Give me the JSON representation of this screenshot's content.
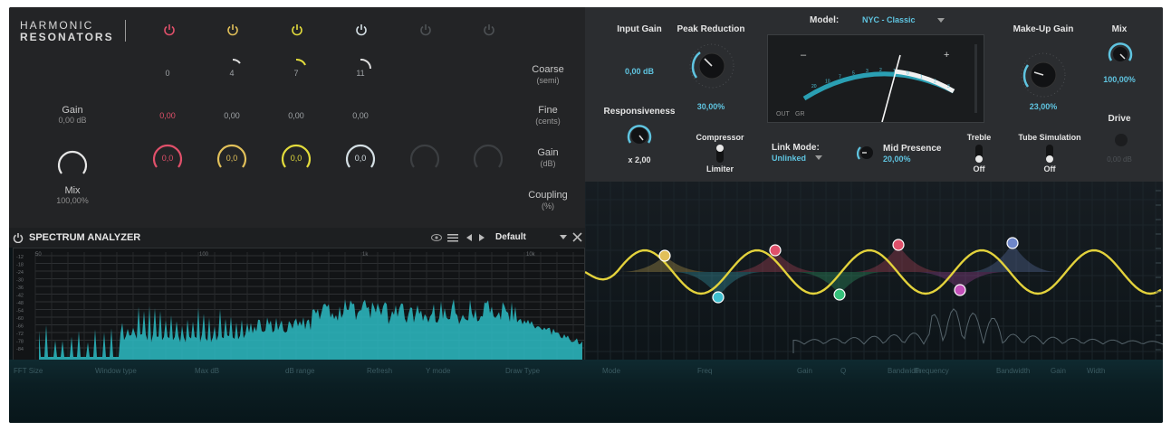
{
  "resonators": {
    "brand_top": "HARMONIC",
    "brand_bottom": "RESONATORS",
    "power_colors": [
      "#e0506a",
      "#e1c05a",
      "#e3dc3c",
      "#d4dfe4",
      "#4d5154",
      "#4d5154"
    ],
    "coarse_values": [
      "0",
      "4",
      "7",
      "11"
    ],
    "fine_values": [
      "0,00",
      "0,00",
      "0,00",
      "0,00"
    ],
    "gain_knob_values": [
      "0,0",
      "0,0",
      "0,0",
      "0,0"
    ],
    "knob_colors": [
      "#e0506a",
      "#e1c05a",
      "#e3dc3c",
      "#d4dfe4",
      "#3c3f42",
      "#3c3f42"
    ],
    "row_coarse": "Coarse",
    "row_coarse_unit": "(semi)",
    "row_fine": "Fine",
    "row_fine_unit": "(cents)",
    "row_gain": "Gain",
    "row_gain_unit": "(dB)",
    "row_coupling": "Coupling",
    "row_coupling_unit": "(%)",
    "gain_label": "Gain",
    "gain_value": "0,00 dB",
    "mix_label": "Mix",
    "mix_value": "100,00%"
  },
  "spectrum": {
    "title": "SPECTRUM ANALYZER",
    "preset": "Default",
    "freq_labels": [
      "50",
      "100",
      "1k",
      "10k"
    ],
    "db_labels": [
      "-12",
      "-18",
      "-24",
      "-30",
      "-36",
      "-42",
      "-48",
      "-54",
      "-60",
      "-66",
      "-72",
      "-78",
      "-84"
    ]
  },
  "compressor": {
    "input_gain_label": "Input Gain",
    "input_gain_value": "0,00 dB",
    "peak_reduction_label": "Peak Reduction",
    "peak_reduction_value": "30,00%",
    "model_label": "Model:",
    "model_value": "NYC - Classic",
    "makeup_label": "Make-Up Gain",
    "makeup_value": "23,00%",
    "mix_label": "Mix",
    "mix_value": "100,00%",
    "responsiveness_label": "Responsiveness",
    "responsiveness_value": "x 2,00",
    "compressor_label": "Compressor",
    "limiter_label": "Limiter",
    "link_mode_label": "Link Mode:",
    "link_mode_value": "Unlinked",
    "mid_presence_label": "Mid Presence",
    "mid_presence_value": "20,00%",
    "treble_label": "Treble",
    "treble_value": "Off",
    "tube_label": "Tube Simulation",
    "tube_value": "Off",
    "drive_label": "Drive",
    "drive_value": "0,00 dB",
    "vu_out": "OUT",
    "vu_gr": "GR",
    "vu_minus": "–",
    "vu_plus": "+",
    "vu_scale": [
      "20",
      "10",
      "7",
      "5",
      "3",
      "2",
      "1",
      "0",
      "1",
      "2",
      "3"
    ]
  },
  "eq": {
    "node_colors": [
      "#e1c05a",
      "#3fbfd0",
      "#e0506a",
      "#35c07a",
      "#e0506a",
      "#c24fb8",
      "#6f87c9"
    ]
  },
  "bottom_bar": {
    "labels": [
      "FFT Size",
      "Window type",
      "Max dB",
      "dB range",
      "Refresh",
      "Y mode",
      "Draw Type",
      "Mode",
      "Freq",
      "Gain",
      "Q",
      "Bandwidth",
      "Frequency",
      "Bandwidth",
      "Gain",
      "Width"
    ]
  }
}
